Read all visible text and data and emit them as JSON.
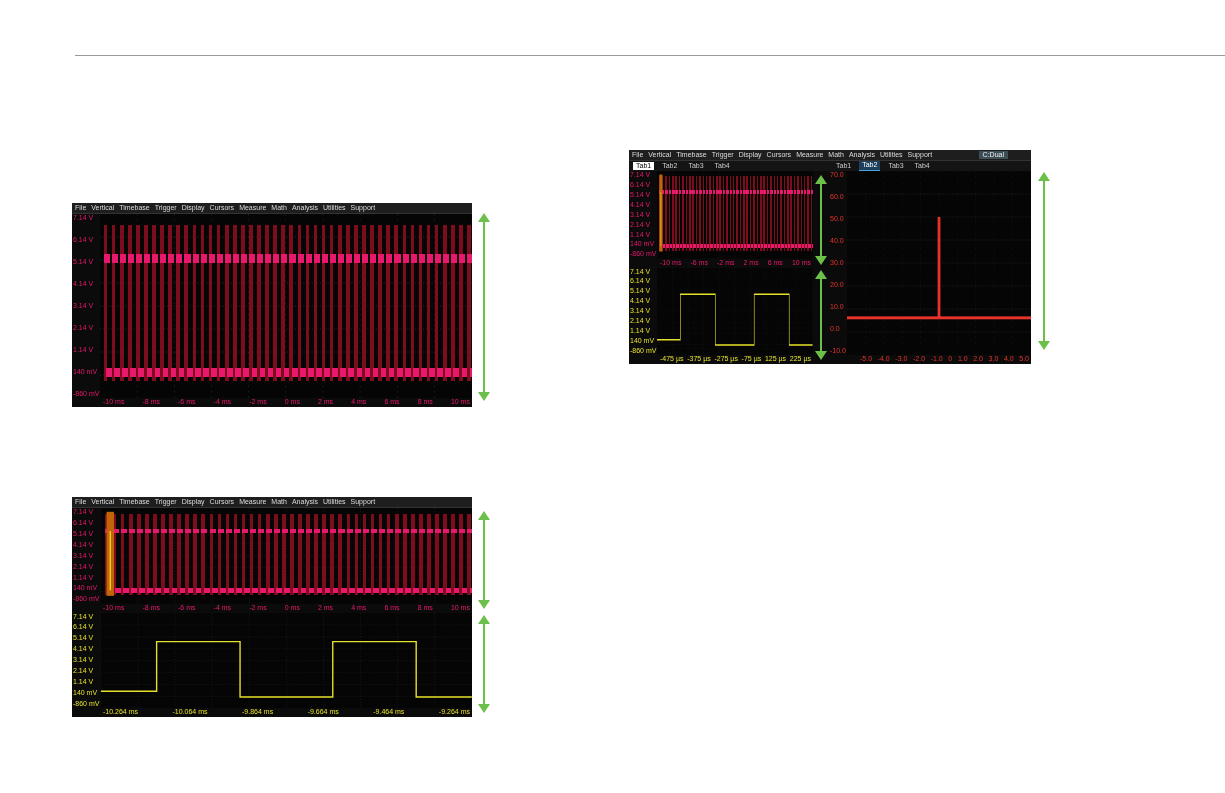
{
  "scopes": [
    {
      "menu": [
        "File",
        "Vertical",
        "Timebase",
        "Trigger",
        "Display",
        "Cursors",
        "Measure",
        "Math",
        "Analysis",
        "Utilities",
        "Support"
      ],
      "panes": [
        {
          "kind": "pulse",
          "color": "#e8186c",
          "y_labels": [
            "7.14 V",
            "6.14 V",
            "5.14 V",
            "4.14 V",
            "3.14 V",
            "2.14 V",
            "1.14 V",
            "140 mV",
            "-860 mV"
          ],
          "x_labels": [
            "-10 ms",
            "-8 ms",
            "-6 ms",
            "-4 ms",
            "-2 ms",
            "0 ms",
            "2 ms",
            "4 ms",
            "6 ms",
            "8 ms",
            "10 ms"
          ]
        }
      ]
    },
    {
      "menu": [
        "File",
        "Vertical",
        "Timebase",
        "Trigger",
        "Display",
        "Cursors",
        "Measure",
        "Math",
        "Analysis",
        "Utilities",
        "Support"
      ],
      "panes": [
        {
          "kind": "zoomed",
          "color": "#e8186c",
          "y_labels": [
            "7.14 V",
            "6.14 V",
            "5.14 V",
            "4.14 V",
            "3.14 V",
            "2.14 V",
            "1.14 V",
            "140 mV",
            "-860 mV"
          ],
          "x_labels": [
            "-10 ms",
            "-8 ms",
            "-6 ms",
            "-4 ms",
            "-2 ms",
            "0 ms",
            "2 ms",
            "4 ms",
            "6 ms",
            "8 ms",
            "10 ms"
          ]
        },
        {
          "kind": "square",
          "color": "#e6e12a",
          "y_labels": [
            "7.14 V",
            "6.14 V",
            "5.14 V",
            "4.14 V",
            "3.14 V",
            "2.14 V",
            "1.14 V",
            "140 mV",
            "-860 mV"
          ],
          "x_labels": [
            "-10.264 ms",
            "-10.064 ms",
            "-9.864 ms",
            "-9.664 ms",
            "-9.464 ms",
            "-9.264 ms"
          ]
        }
      ]
    },
    {
      "menu": [
        "File",
        "Vertical",
        "Timebase",
        "Trigger",
        "Display",
        "Cursors",
        "Measure",
        "Math",
        "Analysis",
        "Utilities",
        "Support"
      ],
      "badge": "C:Dual",
      "left_tabs": [
        {
          "label": "Tab1",
          "selected": true
        },
        {
          "label": "Tab2",
          "selected": false
        },
        {
          "label": "Tab3",
          "selected": false
        },
        {
          "label": "Tab4",
          "selected": false
        }
      ],
      "right_tabs": [
        {
          "label": "Tab1",
          "selected": false
        },
        {
          "label": "Tab2",
          "selected": true
        },
        {
          "label": "Tab3",
          "selected": false
        },
        {
          "label": "Tab4",
          "selected": false
        }
      ],
      "panes": [
        {
          "kind": "zoomed",
          "color": "#e8186c",
          "y_labels": [
            "7.14 V",
            "6.14 V",
            "5.14 V",
            "4.14 V",
            "3.14 V",
            "2.14 V",
            "1.14 V",
            "140 mV",
            "-860 mV"
          ],
          "x_labels": [
            "-10 ms",
            "-6 ms",
            "-2 ms",
            "2 ms",
            "6 ms",
            "10 ms"
          ]
        },
        {
          "kind": "square",
          "color": "#e6e12a",
          "y_labels": [
            "7.14 V",
            "6.14 V",
            "5.14 V",
            "4.14 V",
            "3.14 V",
            "2.14 V",
            "1.14 V",
            "140 mV",
            "-860 mV"
          ],
          "x_labels": [
            "-475 µs",
            "-375 µs",
            "-275 µs",
            "-75 µs",
            "125 µs",
            "225 µs"
          ]
        }
      ],
      "right_pane": {
        "kind": "spike",
        "color": "#e8322a",
        "y_labels": [
          "70.0",
          "60.0",
          "50.0",
          "40.0",
          "30.0",
          "20.0",
          "10.0",
          "0.0",
          "-10.0"
        ],
        "x_labels": [
          "-5.0",
          "-4.0",
          "-3.0",
          "-2.0",
          "-1.0",
          "0",
          "1.0",
          "2.0",
          "3.0",
          "4.0",
          "5.0"
        ]
      }
    }
  ]
}
